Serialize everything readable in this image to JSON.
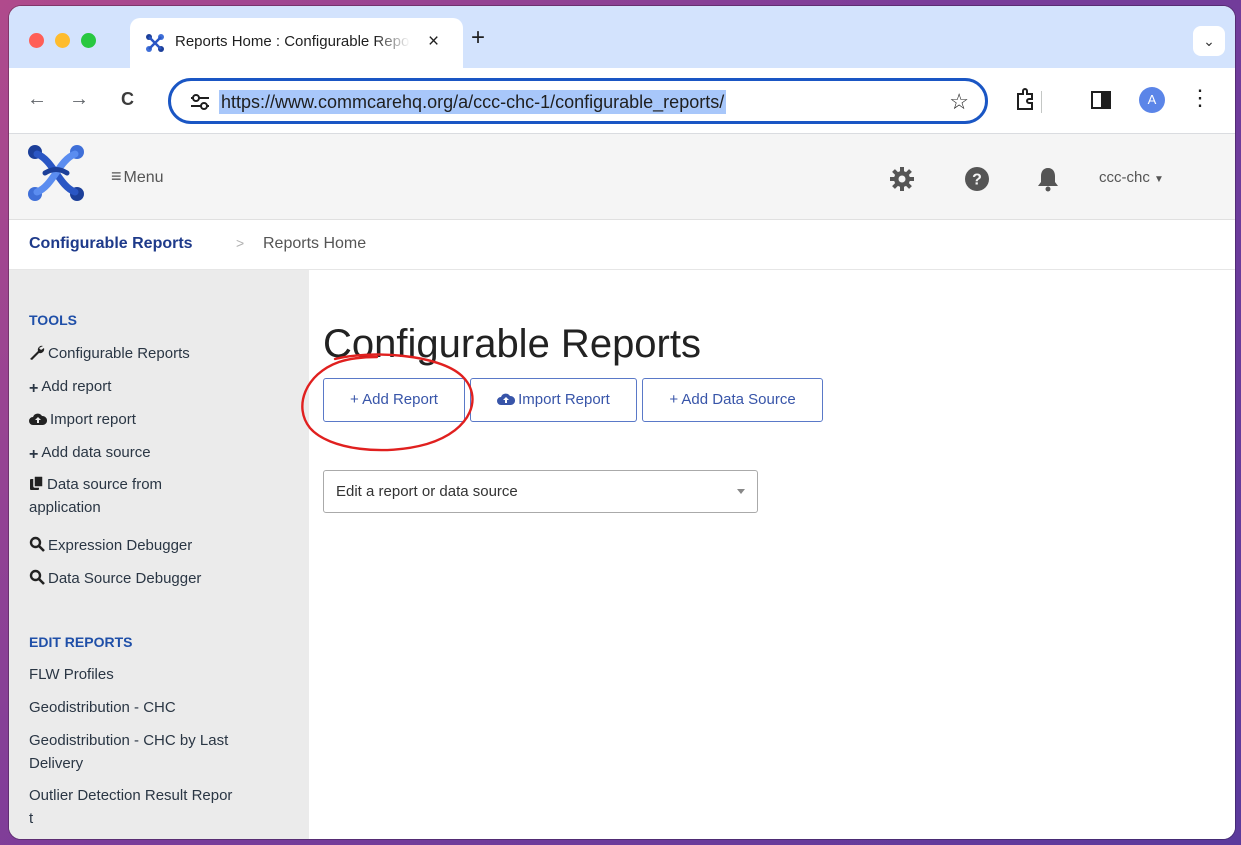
{
  "browser": {
    "tab_title": "Reports Home : Configurable Reports",
    "tab_close": "×",
    "new_tab": "+",
    "url": "https://www.commcarehq.org/a/ccc-chc-1/configurable_reports/",
    "profile_initial": "A",
    "back": "←",
    "forward": "→",
    "reload": "C",
    "star": "☆",
    "kebab": "⋮",
    "tab_search": "⌄"
  },
  "navbar": {
    "menu_label": "Menu",
    "domain": "ccc-chc",
    "icons": [
      "gear-icon",
      "help-icon",
      "bell-icon"
    ]
  },
  "breadcrumb": {
    "parent": "Configurable Reports",
    "separator": ">",
    "current": "Reports Home"
  },
  "sidebar": {
    "tools_header": "TOOLS",
    "tools": [
      {
        "label": "Configurable Reports",
        "icon": "wrench-icon"
      },
      {
        "label": "Add report",
        "icon": "plus-icon"
      },
      {
        "label": "Import report",
        "icon": "cloud-upload-icon"
      },
      {
        "label": "Add data source",
        "icon": "plus-icon"
      },
      {
        "label": "Data source from",
        "label2": "application",
        "icon": "copy-icon"
      },
      {
        "label": "Expression Debugger",
        "icon": "search-icon"
      },
      {
        "label": "Data Source Debugger",
        "icon": "search-icon"
      }
    ],
    "edit_header": "EDIT REPORTS",
    "reports": [
      {
        "label": "FLW Profiles"
      },
      {
        "label": "Geodistribution - CHC"
      },
      {
        "label": "Geodistribution - CHC by Last",
        "label2": "Delivery"
      },
      {
        "label": "Outlier Detection Result Repor",
        "label2": "t"
      }
    ]
  },
  "main": {
    "title": "Configurable Reports",
    "buttons": {
      "add_report": "+ Add Report",
      "import_report": "Import Report",
      "add_data_source": "+ Add Data Source"
    },
    "select_value": "Edit a report or data source"
  },
  "colors": {
    "link": "#1e3a8a",
    "button_text": "#3855a9",
    "annotation": "#e0201f"
  }
}
